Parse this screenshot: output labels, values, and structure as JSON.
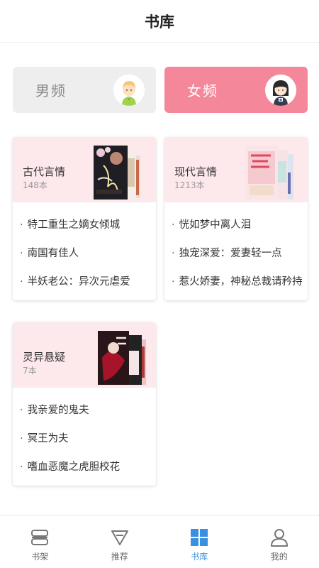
{
  "header": {
    "title": "书库"
  },
  "channels": [
    {
      "label": "男频",
      "icon": "boy-avatar-icon",
      "selected": false
    },
    {
      "label": "女频",
      "icon": "girl-avatar-icon",
      "selected": true
    }
  ],
  "categories": [
    {
      "title": "古代言情",
      "count": "148本",
      "books": [
        "特工重生之嫡女倾城",
        "南国有佳人",
        "半妖老公：异次元虐爱"
      ]
    },
    {
      "title": "现代言情",
      "count": "1213本",
      "books": [
        "恍如梦中离人泪",
        "独宠深爱：爱妻轻一点",
        "惹火娇妻，神秘总裁请矜持"
      ]
    },
    {
      "title": "灵异悬疑",
      "count": "7本",
      "books": [
        "我亲爱的鬼夫",
        "冥王为夫",
        "嗜血恶魔之虎胆校花"
      ]
    }
  ],
  "tabbar": {
    "items": [
      {
        "label": "书架",
        "icon": "bookshelf-icon"
      },
      {
        "label": "推荐",
        "icon": "recommend-icon"
      },
      {
        "label": "书库",
        "icon": "library-grid-icon",
        "active": true
      },
      {
        "label": "我的",
        "icon": "profile-icon"
      }
    ]
  },
  "colors": {
    "accent": "#3b8fe0",
    "female": "#f5879b",
    "card_head": "#fde8ec"
  }
}
